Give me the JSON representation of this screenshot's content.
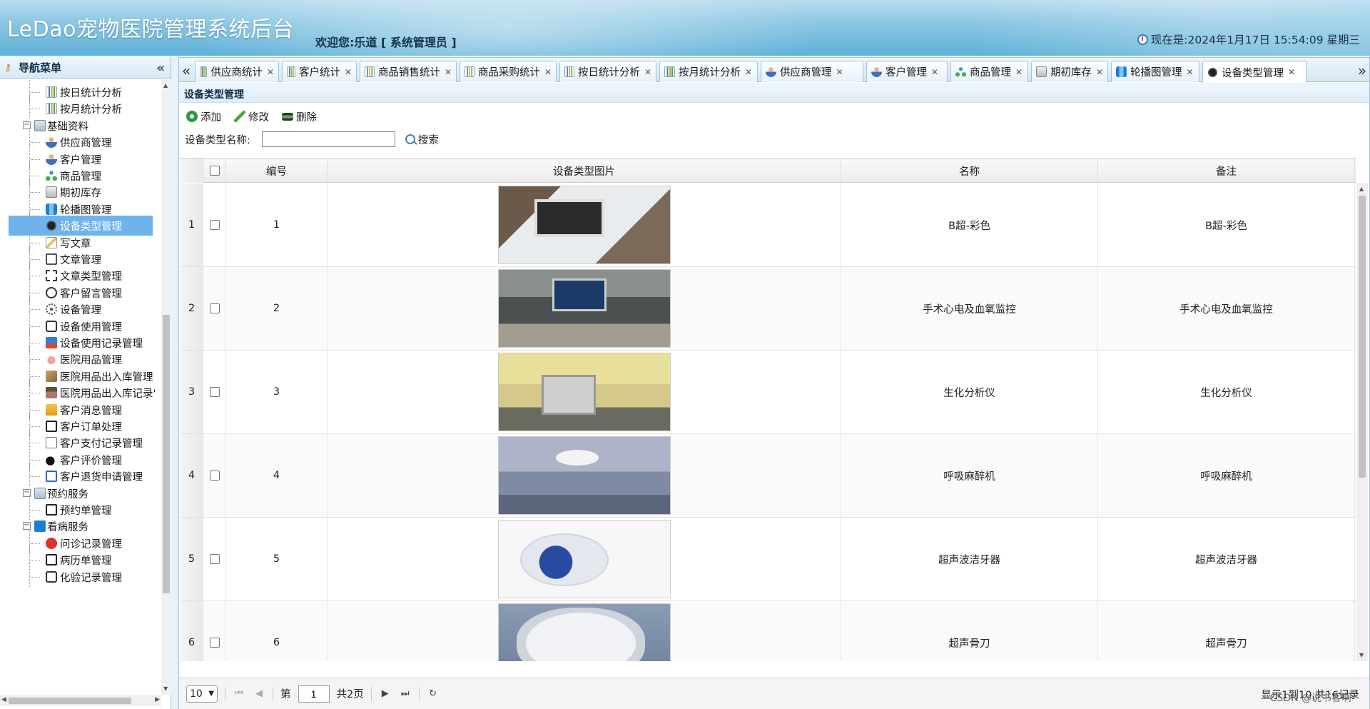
{
  "header": {
    "app_title": "LeDao宠物医院管理系统后台",
    "welcome": "欢迎您:乐道 [ 系统管理员 ]",
    "clock_text": "现在是:2024年1月17日 15:54:09 星期三"
  },
  "sidebar": {
    "title": "导航菜单",
    "items": [
      {
        "type": "leaf",
        "label": "按日统计分析",
        "icon": "chart-icon"
      },
      {
        "type": "leaf",
        "label": "按月统计分析",
        "icon": "chart-icon"
      },
      {
        "type": "group",
        "label": "基础资料",
        "icon": "folder-icon"
      },
      {
        "type": "leaf",
        "label": "供应商管理",
        "icon": "user-icon"
      },
      {
        "type": "leaf",
        "label": "客户管理",
        "icon": "user-icon"
      },
      {
        "type": "leaf",
        "label": "商品管理",
        "icon": "goods-icon"
      },
      {
        "type": "leaf",
        "label": "期初库存",
        "icon": "stock-icon"
      },
      {
        "type": "leaf",
        "label": "轮播图管理",
        "icon": "carousel-icon"
      },
      {
        "type": "leaf",
        "label": "设备类型管理",
        "icon": "chip-icon",
        "selected": true
      },
      {
        "type": "leaf",
        "label": "写文章",
        "icon": "write-icon"
      },
      {
        "type": "leaf",
        "label": "文章管理",
        "icon": "doc-icon"
      },
      {
        "type": "leaf",
        "label": "文章类型管理",
        "icon": "frame-icon"
      },
      {
        "type": "leaf",
        "label": "客户留言管理",
        "icon": "bubble-icon"
      },
      {
        "type": "leaf",
        "label": "设备管理",
        "icon": "tools-icon"
      },
      {
        "type": "leaf",
        "label": "设备使用管理",
        "icon": "use-icon"
      },
      {
        "type": "leaf",
        "label": "设备使用记录管理",
        "icon": "monitor-icon"
      },
      {
        "type": "leaf",
        "label": "医院用品管理",
        "icon": "bottle-icon"
      },
      {
        "type": "leaf",
        "label": "医院用品出入库管理",
        "icon": "box-icon"
      },
      {
        "type": "leaf",
        "label": "医院用品出入库记录'",
        "icon": "house-icon"
      },
      {
        "type": "leaf",
        "label": "客户消息管理",
        "icon": "msg-icon"
      },
      {
        "type": "leaf",
        "label": "客户订单处理",
        "icon": "clip-icon"
      },
      {
        "type": "leaf",
        "label": "客户支付记录管理",
        "icon": "pay-icon"
      },
      {
        "type": "leaf",
        "label": "客户评价管理",
        "icon": "thumb-icon"
      },
      {
        "type": "leaf",
        "label": "客户退货申请管理",
        "icon": "grid-icon"
      },
      {
        "type": "group",
        "label": "预约服务",
        "icon": "folder-icon"
      },
      {
        "type": "leaf",
        "label": "预约单管理",
        "icon": "clip-icon"
      },
      {
        "type": "group",
        "label": "看病服务",
        "icon": "plus-icon"
      },
      {
        "type": "leaf",
        "label": "问诊记录管理",
        "icon": "redcross-icon"
      },
      {
        "type": "leaf",
        "label": "病历单管理",
        "icon": "clip-icon"
      },
      {
        "type": "leaf",
        "label": "化验记录管理",
        "icon": "flask-icon"
      }
    ]
  },
  "tabs": [
    {
      "label": "供应商统计",
      "icon": "chart-icon"
    },
    {
      "label": "客户统计",
      "icon": "chart-icon"
    },
    {
      "label": "商品销售统计",
      "icon": "chart-icon"
    },
    {
      "label": "商品采购统计",
      "icon": "chart-icon"
    },
    {
      "label": "按日统计分析",
      "icon": "chart-icon"
    },
    {
      "label": "按月统计分析",
      "icon": "chart-icon"
    },
    {
      "label": "供应商管理",
      "icon": "user-icon"
    },
    {
      "label": "客户管理",
      "icon": "user-icon"
    },
    {
      "label": "商品管理",
      "icon": "goods-icon"
    },
    {
      "label": "期初库存",
      "icon": "stock-icon"
    },
    {
      "label": "轮播图管理",
      "icon": "carousel-icon"
    },
    {
      "label": "设备类型管理",
      "icon": "chip-icon",
      "active": true
    }
  ],
  "panel": {
    "title": "设备类型管理",
    "toolbar": {
      "add": "添加",
      "edit": "修改",
      "delete": "删除"
    },
    "search": {
      "label": "设备类型名称:",
      "value": "",
      "button": "搜索"
    }
  },
  "grid": {
    "columns": [
      "编号",
      "设备类型图片",
      "名称",
      "备注"
    ],
    "rows": [
      {
        "rownum": "1",
        "id": "1",
        "image": "ultrasound-image",
        "name": "B超-彩色",
        "remark": "B超-彩色"
      },
      {
        "rownum": "2",
        "id": "2",
        "image": "monitor-image",
        "name": "手术心电及血氧监控",
        "remark": "手术心电及血氧监控"
      },
      {
        "rownum": "3",
        "id": "3",
        "image": "analyzer-image",
        "name": "生化分析仪",
        "remark": "生化分析仪"
      },
      {
        "rownum": "4",
        "id": "4",
        "image": "anesthesia-image",
        "name": "呼吸麻醉机",
        "remark": "呼吸麻醉机"
      },
      {
        "rownum": "5",
        "id": "5",
        "image": "scaler-image",
        "name": "超声波洁牙器",
        "remark": "超声波洁牙器"
      },
      {
        "rownum": "6",
        "id": "6",
        "image": "bone-knife-image",
        "name": "超声骨刀",
        "remark": "超声骨刀"
      }
    ]
  },
  "pager": {
    "page_size": "10",
    "page_label_prefix": "第",
    "page_value": "1",
    "page_total": "共2页",
    "info": "显示1到10,共16记录"
  },
  "watermark": "CSDN @说书客啊"
}
